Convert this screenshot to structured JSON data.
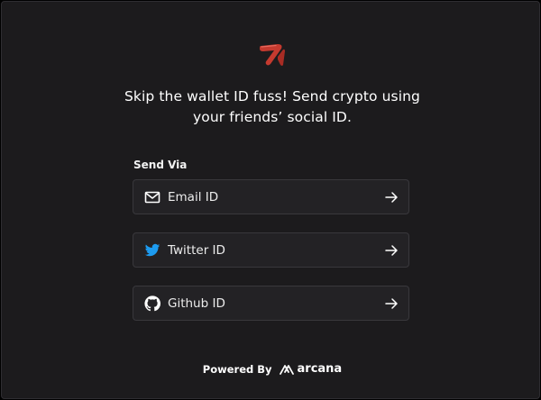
{
  "headline": {
    "line1": "Skip the wallet ID fuss! Send crypto using",
    "line2": "your friends’ social ID."
  },
  "send_via": {
    "label": "Send Via",
    "options": [
      {
        "label": "Email ID",
        "icon": "mail-icon"
      },
      {
        "label": "Twitter ID",
        "icon": "twitter-icon",
        "icon_color": "#1d9bf0"
      },
      {
        "label": "Github ID",
        "icon": "github-icon"
      }
    ]
  },
  "footer": {
    "powered_by": "Powered By",
    "brand": "arcana"
  },
  "colors": {
    "background": "#1c1b1d",
    "option_background": "#232225",
    "logo_red": "#c53a2f"
  }
}
